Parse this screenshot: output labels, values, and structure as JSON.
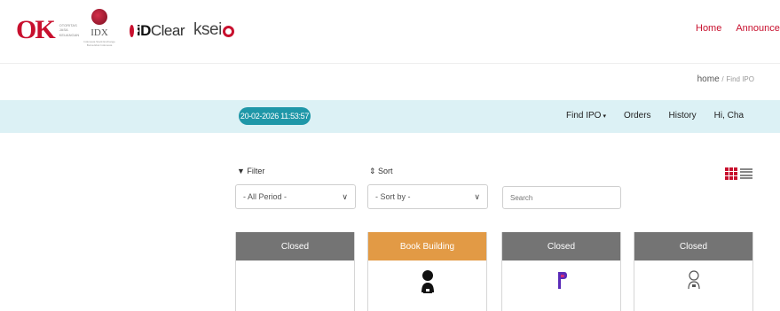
{
  "header": {
    "logos": {
      "ojk": {
        "mark": "OK",
        "text": "OTORITAS JASA KEUANGAN"
      },
      "idx": {
        "text": "IDX",
        "sub": "Indonesia Stock Exchange Bursa Efek Indonesia"
      },
      "idclear": {
        "text_bold": "iD",
        "text": "Clear"
      },
      "ksei": {
        "text": "ksei"
      }
    },
    "nav": [
      {
        "label": "Home"
      },
      {
        "label": "Announcement"
      }
    ]
  },
  "breadcrumb": {
    "home": "home",
    "sep": "/",
    "current": "Find IPO"
  },
  "toolbar": {
    "datetime": "20-02-2026 11:53:57",
    "nav": [
      {
        "label": "Find IPO",
        "caret": "▾"
      },
      {
        "label": "Orders"
      },
      {
        "label": "History"
      },
      {
        "label": "Hi, Cha"
      }
    ]
  },
  "filters": {
    "filter_label": "▼ Filter",
    "sort_label": "⇕ Sort",
    "period_value": "- All Period -",
    "sort_value": "- Sort by -",
    "search_placeholder": "Search",
    "chevron": "∨"
  },
  "cards": [
    {
      "status": "Closed",
      "variant": "closed"
    },
    {
      "status": "Book Building",
      "variant": "bb"
    },
    {
      "status": "Closed",
      "variant": "closed"
    },
    {
      "status": "Closed",
      "variant": "closed"
    }
  ],
  "colors": {
    "brand_red": "#c8102e",
    "teal_bar": "#dcf1f5",
    "datetime_pill": "#1f97a8",
    "closed_header": "#747474",
    "book_building_header": "#e29a45"
  }
}
